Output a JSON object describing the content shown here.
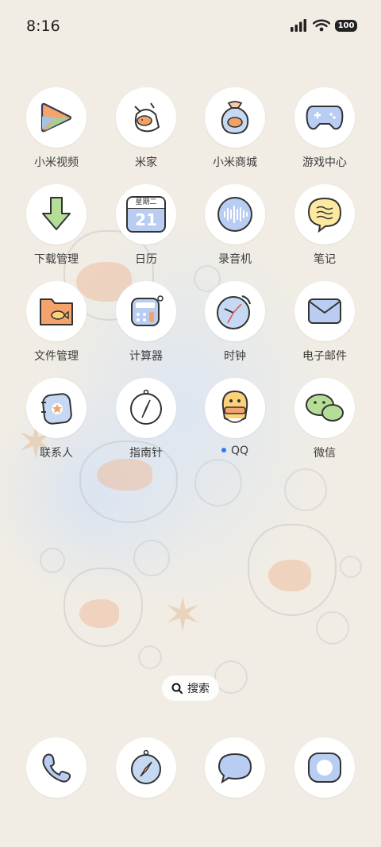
{
  "status_bar": {
    "time": "8:16",
    "battery": "100"
  },
  "apps": [
    {
      "label": "小米视频",
      "icon": "video-play-icon"
    },
    {
      "label": "米家",
      "icon": "mijia-cat-icon"
    },
    {
      "label": "小米商城",
      "icon": "shopping-bag-icon"
    },
    {
      "label": "游戏中心",
      "icon": "gamepad-icon"
    },
    {
      "label": "下载管理",
      "icon": "download-arrow-icon"
    },
    {
      "label": "日历",
      "icon": "calendar-icon",
      "calendar_day": "21",
      "calendar_week": "星期二"
    },
    {
      "label": "录音机",
      "icon": "recorder-wave-icon"
    },
    {
      "label": "笔记",
      "icon": "note-bubble-icon"
    },
    {
      "label": "文件管理",
      "icon": "folder-icon"
    },
    {
      "label": "计算器",
      "icon": "calculator-icon"
    },
    {
      "label": "时钟",
      "icon": "clock-icon"
    },
    {
      "label": "电子邮件",
      "icon": "mail-icon"
    },
    {
      "label": "联系人",
      "icon": "contacts-icon"
    },
    {
      "label": "指南针",
      "icon": "compass-icon"
    },
    {
      "label": "QQ",
      "icon": "qq-penguin-icon",
      "new_install_dot": true
    },
    {
      "label": "微信",
      "icon": "wechat-icon"
    }
  ],
  "search": {
    "label": "搜索"
  },
  "dock": [
    {
      "icon": "phone-icon"
    },
    {
      "icon": "browser-icon"
    },
    {
      "icon": "messages-icon"
    },
    {
      "icon": "camera-icon"
    }
  ]
}
